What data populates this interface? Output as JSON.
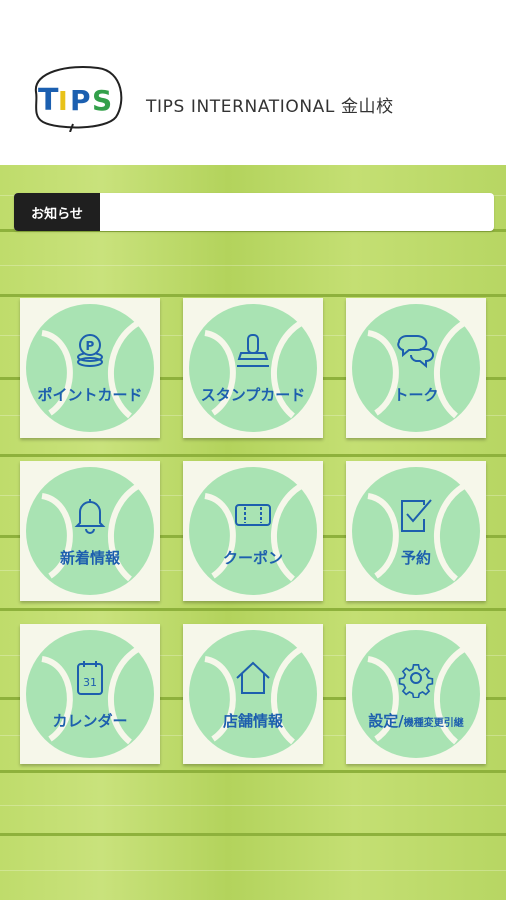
{
  "header": {
    "logo_text": "TIPS",
    "brand_name": "TIPS INTERNATIONAL 金山校"
  },
  "news": {
    "label": "お知らせ",
    "text": ""
  },
  "menu": [
    {
      "label": "ポイントカード",
      "icon": "point-coin-icon"
    },
    {
      "label": "スタンプカード",
      "icon": "stamp-icon"
    },
    {
      "label": "トーク",
      "icon": "chat-bubbles-icon"
    },
    {
      "label": "新着情報",
      "icon": "bell-icon"
    },
    {
      "label": "クーポン",
      "icon": "coupon-icon"
    },
    {
      "label": "予約",
      "icon": "clipboard-check-icon"
    },
    {
      "label": "カレンダー",
      "icon": "calendar-icon"
    },
    {
      "label": "店舗情報",
      "icon": "home-icon"
    },
    {
      "label_main": "設定/",
      "label_sub": "機種変更引継",
      "icon": "gear-icon"
    }
  ],
  "colors": {
    "accent": "#1d5fae",
    "tile_circle": "#a9e3b3",
    "background": "#b5d65a"
  }
}
